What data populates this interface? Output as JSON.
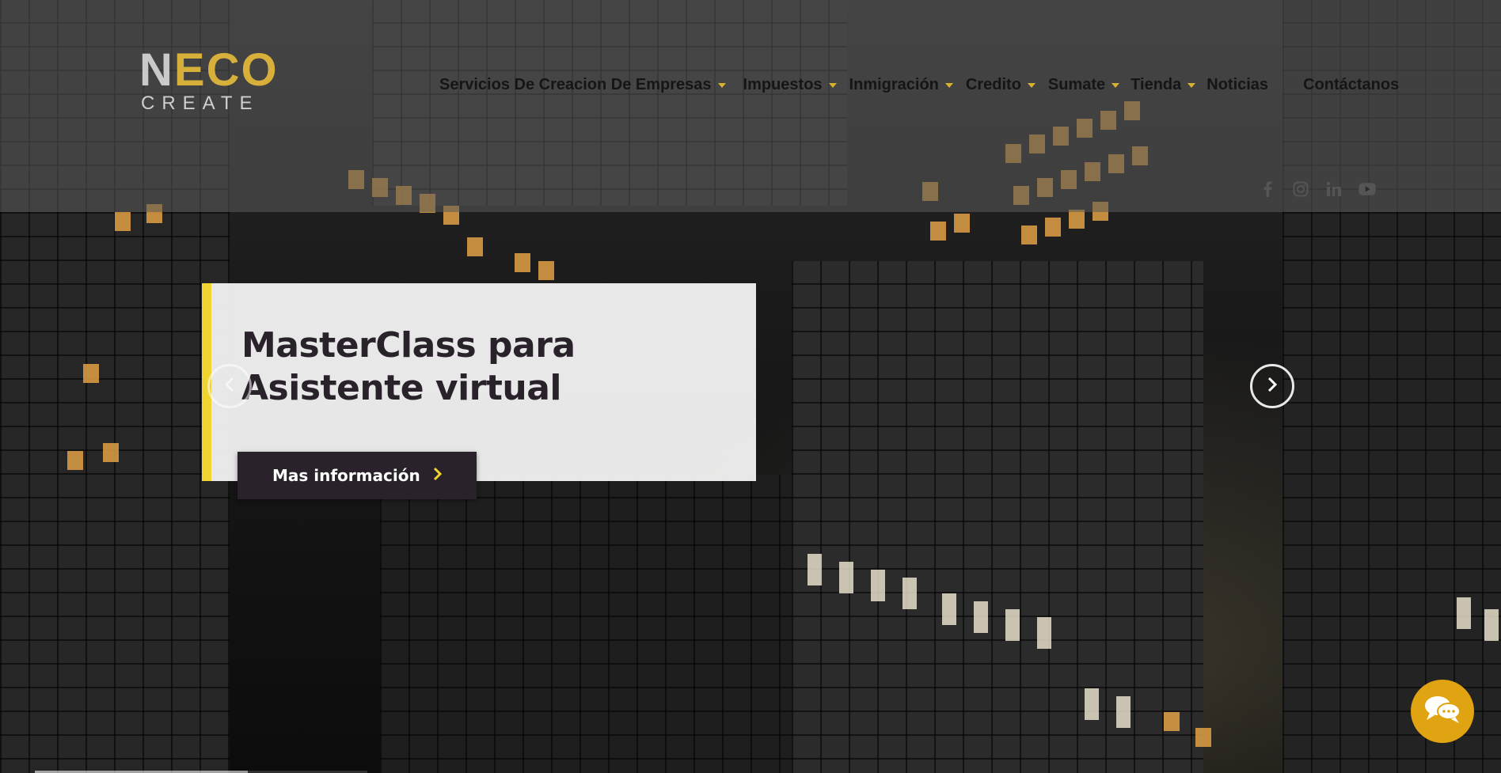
{
  "brand": {
    "logo_top_prefix": "N",
    "logo_top_gold": "E",
    "logo_top_rest": "CO",
    "logo_bottom": "CREATE",
    "accent_color": "#f0d430",
    "dark_color": "#2a222b",
    "chat_color": "#e0a412"
  },
  "nav": {
    "items": [
      {
        "label": "Servicios De Creacion De Empresas",
        "has_dropdown": true
      },
      {
        "label": "Impuestos",
        "has_dropdown": true
      },
      {
        "label": "Inmigración",
        "has_dropdown": true
      },
      {
        "label": "Credito",
        "has_dropdown": true
      },
      {
        "label": "Sumate",
        "has_dropdown": true
      },
      {
        "label": "Tienda",
        "has_dropdown": true
      },
      {
        "label": "Noticias",
        "has_dropdown": false
      },
      {
        "label": "Contáctanos",
        "has_dropdown": false
      }
    ]
  },
  "social": {
    "icons": [
      "facebook-icon",
      "instagram-icon",
      "linkedin-icon",
      "youtube-icon"
    ]
  },
  "slide": {
    "title_line1": "MasterClass para",
    "title_line2": "Asistente virtual",
    "cta_label": "Mas información",
    "cta_icon": "chevron-right-icon"
  },
  "slider": {
    "prev_icon": "chevron-left-icon",
    "next_icon": "chevron-right-icon",
    "progress": 0.64
  },
  "chat": {
    "icon": "chat-bubbles-icon"
  }
}
